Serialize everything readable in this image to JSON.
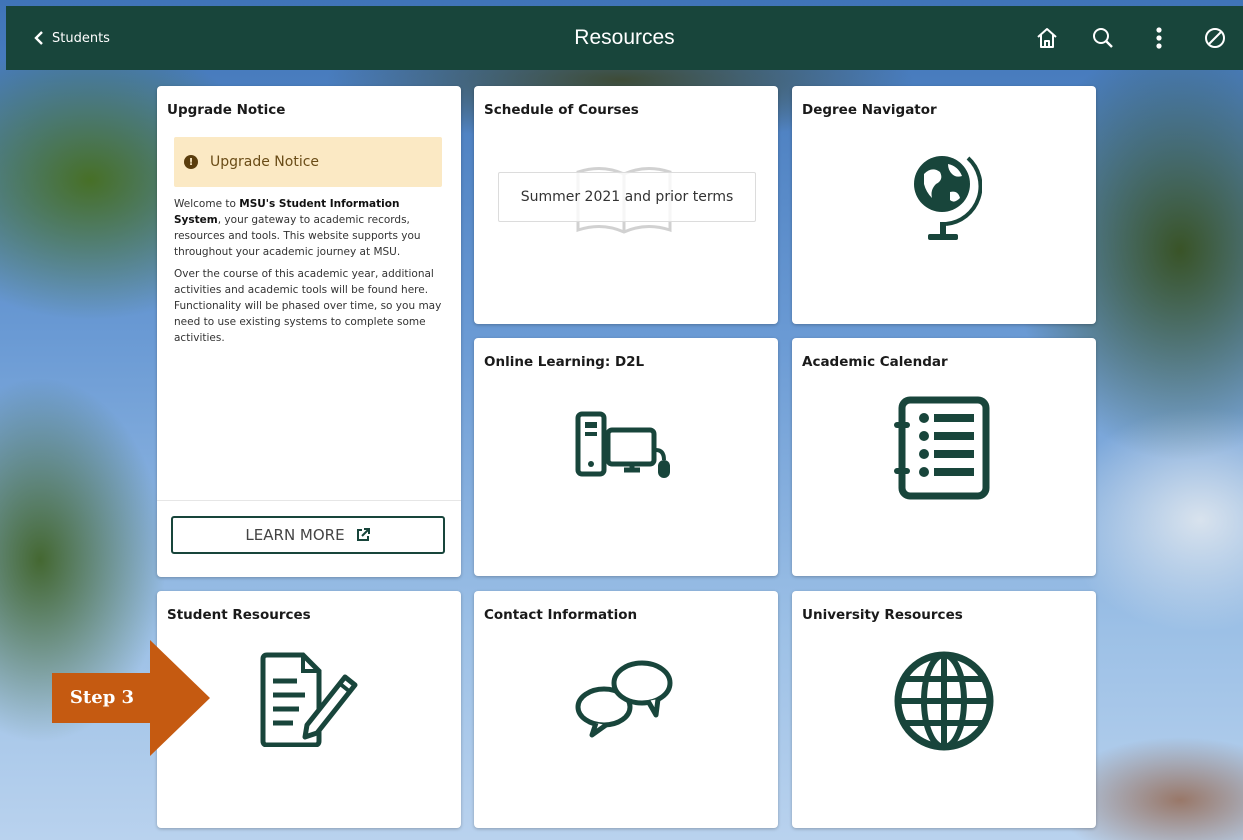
{
  "header": {
    "back_label": "Students",
    "title": "Resources",
    "icons": [
      "home-icon",
      "search-icon",
      "more-vertical-icon",
      "no-entry-icon"
    ]
  },
  "tiles": {
    "upgrade_notice": {
      "title": "Upgrade Notice",
      "banner": "Upgrade Notice",
      "para1_pre": "Welcome to ",
      "para1_bold": "MSU's Student Information System",
      "para1_post": ", your gateway to academic records, resources and tools. This website supports you throughout your academic journey at MSU.",
      "para2": "Over the course of this academic year, additional activities and academic tools will be found here. Functionality will be phased over time, so you may need to use existing systems to complete some activities.",
      "button": "LEARN MORE"
    },
    "schedule": {
      "title": "Schedule of Courses",
      "box_text": "Summer 2021 and prior terms"
    },
    "degree": {
      "title": "Degree Navigator"
    },
    "online": {
      "title": "Online Learning: D2L"
    },
    "calendar": {
      "title": "Academic Calendar"
    },
    "student_resources": {
      "title": "Student Resources"
    },
    "contact": {
      "title": "Contact Information"
    },
    "university": {
      "title": "University Resources"
    }
  },
  "annotation": {
    "step_label": "Step 3",
    "color": "#c55a11"
  },
  "colors": {
    "header": "#18453b",
    "icon": "#18453b",
    "notice_bg": "#fbe9c4"
  }
}
